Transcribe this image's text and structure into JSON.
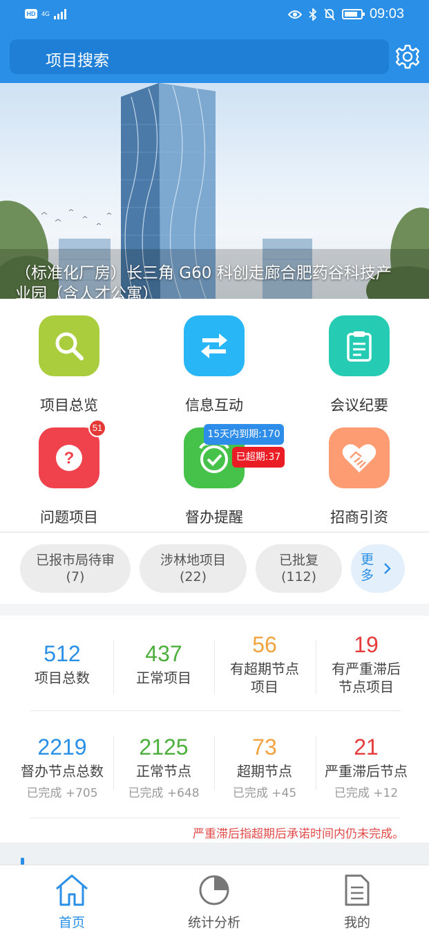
{
  "status_bar": {
    "hd": "HD",
    "network": "4G",
    "time": "09:03"
  },
  "header": {
    "search_placeholder": "项目搜索"
  },
  "banner": {
    "caption_line1": "（标准化厂房）长三角 G60 科创走廊合肥药谷科技产",
    "caption_line2": "业园（含人才公寓）"
  },
  "functions": [
    {
      "label": "项目总览",
      "icon": "search-icon",
      "color": "#aacd3e"
    },
    {
      "label": "信息互动",
      "icon": "swap-arrows-icon",
      "color": "#29b6f6"
    },
    {
      "label": "会议纪要",
      "icon": "clipboard-icon",
      "color": "#26cbb4"
    },
    {
      "label": "问题项目",
      "icon": "question-icon",
      "color": "#f0424d",
      "badge": "51"
    },
    {
      "label": "督办提醒",
      "icon": "alarm-clock-icon",
      "color": "#46c24a"
    },
    {
      "label": "招商引资",
      "icon": "handshake-heart-icon",
      "color": "#fd9c72"
    }
  ],
  "reminder_tags": {
    "due_15_days": "15天内到期:170",
    "overdue": "已超期:37"
  },
  "chips": [
    {
      "label": "已报市局待审",
      "count": "(7)"
    },
    {
      "label": "涉林地项目",
      "count": "(22)"
    },
    {
      "label": "已批复",
      "count": "(112)"
    }
  ],
  "more": {
    "line1": "更",
    "line2": "多"
  },
  "stats_projects": [
    {
      "value": "512",
      "label1": "项目总数",
      "label2": "",
      "color": "blue"
    },
    {
      "value": "437",
      "label1": "正常项目",
      "label2": "",
      "color": "green"
    },
    {
      "value": "56",
      "label1": "有超期节点",
      "label2": "项目",
      "color": "orange"
    },
    {
      "value": "19",
      "label1": "有严重滞后",
      "label2": "节点项目",
      "color": "red"
    }
  ],
  "stats_nodes": [
    {
      "value": "2219",
      "label": "督办节点总数",
      "sub": "已完成 +705",
      "color": "blue"
    },
    {
      "value": "2125",
      "label": "正常节点",
      "sub": "已完成 +648",
      "color": "green"
    },
    {
      "value": "73",
      "label": "超期节点",
      "sub": "已完成 +45",
      "color": "orange"
    },
    {
      "value": "21",
      "label": "严重滞后节点",
      "sub": "已完成 +12",
      "color": "red"
    }
  ],
  "note": "严重滞后指超期后承诺时间内仍未完成。",
  "nav": [
    {
      "label": "首页",
      "icon": "home-icon",
      "active": true
    },
    {
      "label": "统计分析",
      "icon": "pie-chart-icon",
      "active": false
    },
    {
      "label": "我的",
      "icon": "document-icon",
      "active": false
    }
  ]
}
